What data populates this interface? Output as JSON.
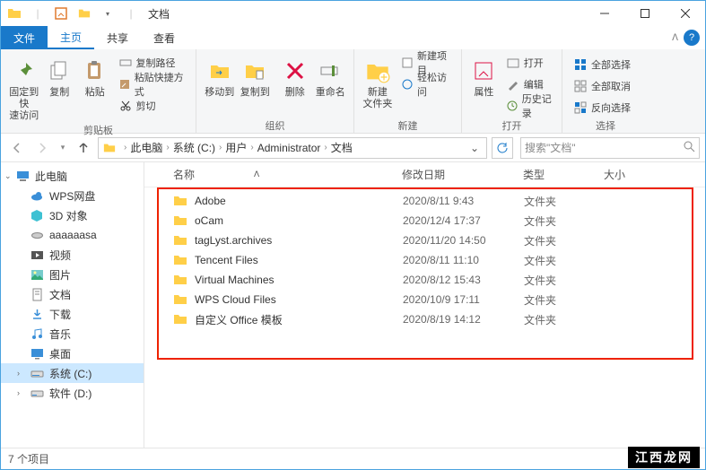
{
  "titlebar": {
    "title": "文档"
  },
  "win": {
    "min": "—",
    "max": "☐",
    "close": "✕"
  },
  "tabs": {
    "file": "文件",
    "home": "主页",
    "share": "共享",
    "view": "查看"
  },
  "ribbon": {
    "pin": "固定到快\n速访问",
    "copy": "复制",
    "paste": "粘贴",
    "copy_path": "复制路径",
    "paste_shortcut": "粘贴快捷方式",
    "cut": "剪切",
    "clipboard_group": "剪贴板",
    "move_to": "移动到",
    "copy_to": "复制到",
    "delete": "删除",
    "rename": "重命名",
    "organize_group": "组织",
    "new_folder": "新建\n文件夹",
    "new_item": "新建项目",
    "easy_access": "轻松访问",
    "new_group": "新建",
    "properties": "属性",
    "open": "打开",
    "edit": "编辑",
    "history": "历史记录",
    "open_group": "打开",
    "select_all": "全部选择",
    "select_none": "全部取消",
    "invert": "反向选择",
    "select_group": "选择"
  },
  "nav": {
    "this_pc": "此电脑",
    "system_c": "系统 (C:)",
    "users": "用户",
    "admin": "Administrator",
    "documents": "文档",
    "search_placeholder": "搜索\"文档\""
  },
  "navpane": {
    "this_pc": "此电脑",
    "wps": "WPS网盘",
    "objects3d": "3D 对象",
    "aaaa": "aaaaaasa",
    "videos": "视频",
    "pictures": "图片",
    "documents": "文档",
    "downloads": "下载",
    "music": "音乐",
    "desktop": "桌面",
    "drive_c": "系统 (C:)",
    "drive_d": "软件 (D:)"
  },
  "columns": {
    "name": "名称",
    "date": "修改日期",
    "type": "类型",
    "size": "大小"
  },
  "files": [
    {
      "name": "Adobe",
      "date": "2020/8/11 9:43",
      "type": "文件夹"
    },
    {
      "name": "oCam",
      "date": "2020/12/4 17:37",
      "type": "文件夹"
    },
    {
      "name": "tagLyst.archives",
      "date": "2020/11/20 14:50",
      "type": "文件夹"
    },
    {
      "name": "Tencent Files",
      "date": "2020/8/11 11:10",
      "type": "文件夹"
    },
    {
      "name": "Virtual Machines",
      "date": "2020/8/12 15:43",
      "type": "文件夹"
    },
    {
      "name": "WPS Cloud Files",
      "date": "2020/10/9 17:11",
      "type": "文件夹"
    },
    {
      "name": "自定义 Office 模板",
      "date": "2020/8/19 14:12",
      "type": "文件夹"
    }
  ],
  "status": {
    "count": "7 个项目"
  },
  "watermark": "江西龙网"
}
